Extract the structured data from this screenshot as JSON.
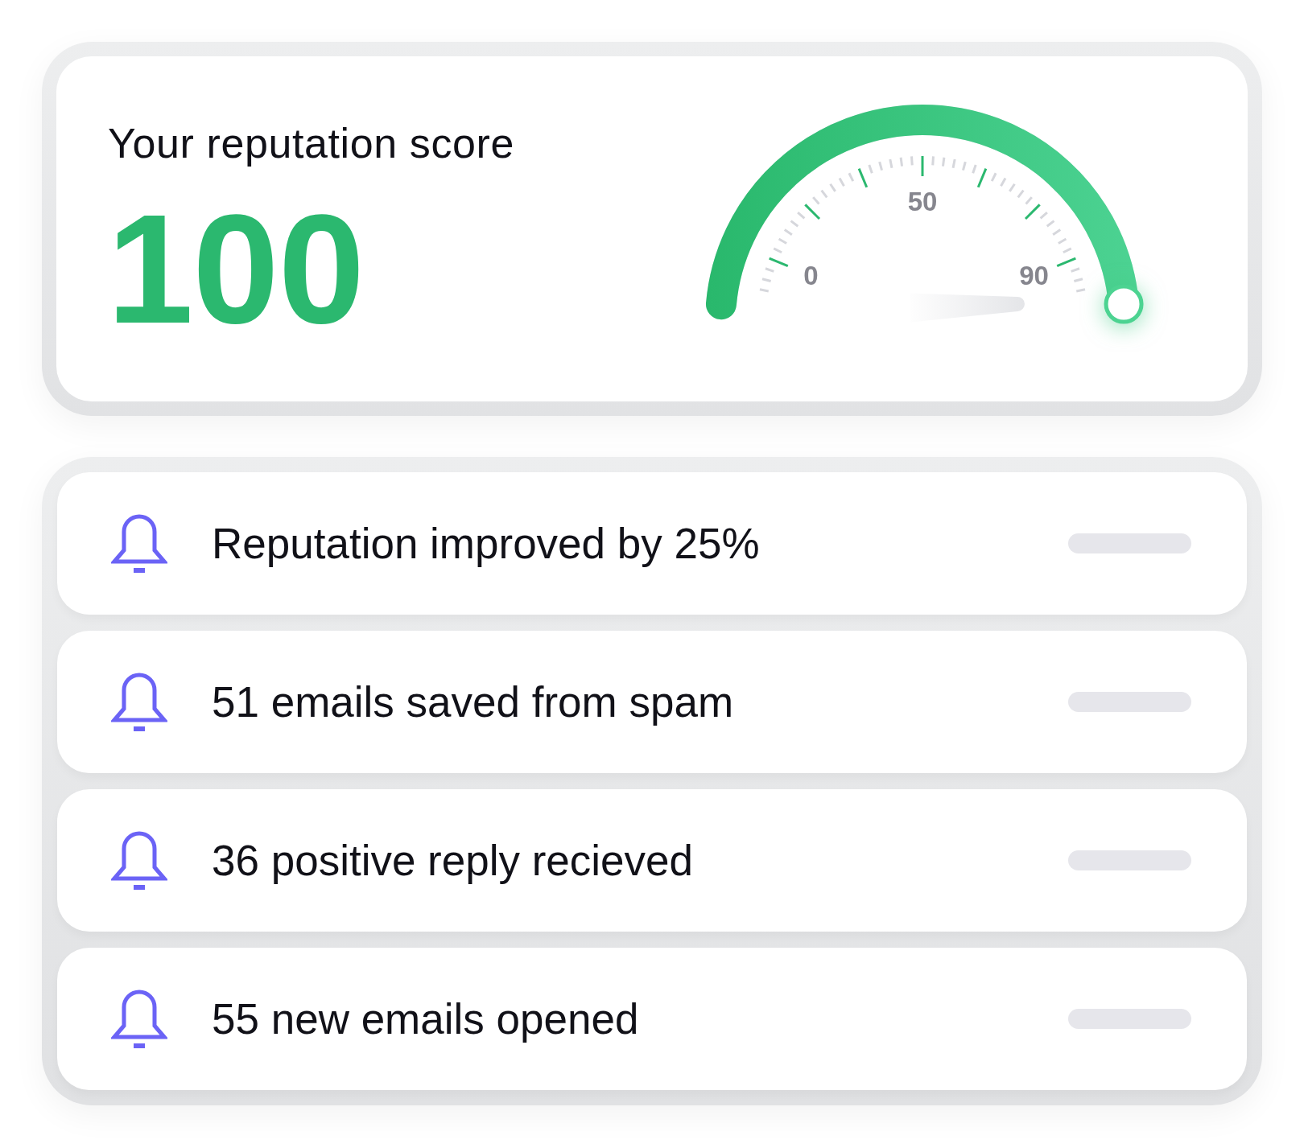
{
  "score_card": {
    "title": "Your reputation score",
    "score": "100",
    "gauge": {
      "level": 1,
      "tick_labels": [
        "0",
        "50",
        "90"
      ]
    }
  },
  "notifications": [
    {
      "text": "Reputation improved by 25%"
    },
    {
      "text": "51 emails saved from spam"
    },
    {
      "text": "36 positive reply recieved"
    },
    {
      "text": "55 new emails opened"
    }
  ]
}
